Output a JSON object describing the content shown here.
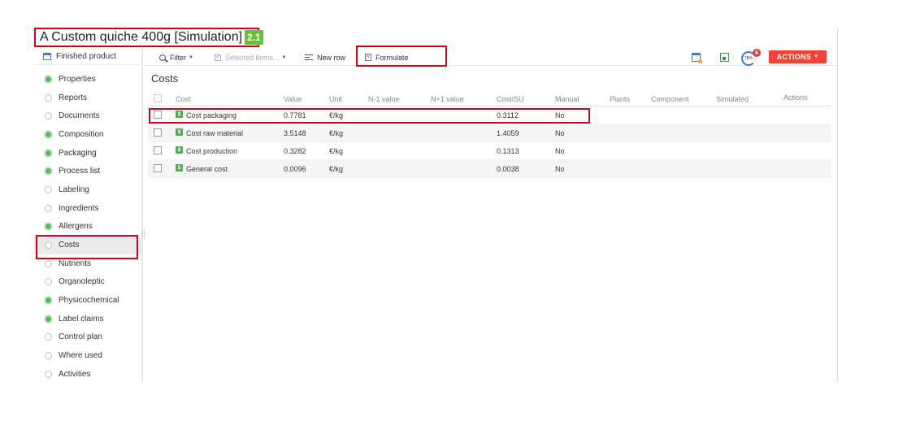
{
  "header": {
    "title": "A Custom quiche 400g [Simulation]",
    "version": "2.1"
  },
  "sidebar": {
    "header": "Finished product",
    "items": [
      {
        "label": "Properties",
        "done": true
      },
      {
        "label": "Reports",
        "done": false
      },
      {
        "label": "Documents",
        "done": false
      },
      {
        "label": "Composition",
        "done": true
      },
      {
        "label": "Packaging",
        "done": true
      },
      {
        "label": "Process list",
        "done": true
      },
      {
        "label": "Labeling",
        "done": false
      },
      {
        "label": "Ingredients",
        "done": false
      },
      {
        "label": "Allergens",
        "done": true
      },
      {
        "label": "Costs",
        "done": false,
        "active": true
      },
      {
        "label": "Nutrients",
        "done": false
      },
      {
        "label": "Organoleptic",
        "done": false
      },
      {
        "label": "Physicochemical",
        "done": true
      },
      {
        "label": "Label claims",
        "done": true
      },
      {
        "label": "Control plan",
        "done": false
      },
      {
        "label": "Where used",
        "done": false
      },
      {
        "label": "Activities",
        "done": false
      }
    ]
  },
  "toolbar": {
    "filter": "Filter",
    "selected_items": "Selected items...",
    "new_row": "New row",
    "formulate": "Formulate",
    "progress": "78%",
    "notifications": "6",
    "actions": "ACTIONS"
  },
  "main": {
    "title": "Costs",
    "columns": [
      "Cost",
      "Value",
      "Unit",
      "N-1 value",
      "N+1 value",
      "Cost/SU",
      "Manual",
      "Plants",
      "Component",
      "Simulated",
      "Actions"
    ],
    "rows": [
      {
        "cost": "Cost packaging",
        "value": "0.7781",
        "unit": "€/kg",
        "cost_su": "0.3112",
        "manual": "No"
      },
      {
        "cost": "Cost raw material",
        "value": "3.5148",
        "unit": "€/kg",
        "cost_su": "1.4059",
        "manual": "No"
      },
      {
        "cost": "Cost production",
        "value": "0.3282",
        "unit": "€/kg",
        "cost_su": "0.1313",
        "manual": "No"
      },
      {
        "cost": "General cost",
        "value": "0.0096",
        "unit": "€/kg",
        "cost_su": "0.0038",
        "manual": "No"
      }
    ],
    "cost_icon": "$"
  },
  "colors": {
    "accent": "#f44336",
    "highlight": "#d0021b",
    "done": "#5cb85c",
    "version_badge": "#6abf3a"
  }
}
